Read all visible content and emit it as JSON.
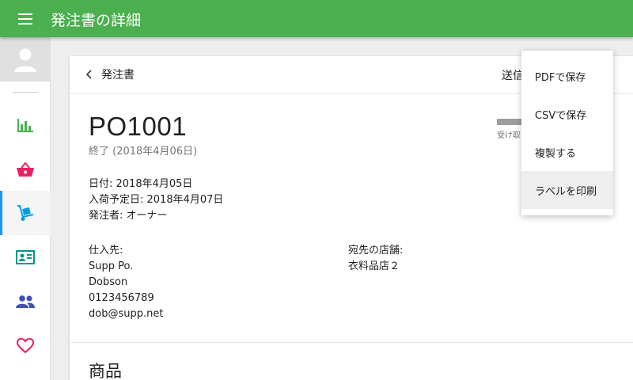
{
  "appbar": {
    "title": "発注書の詳細"
  },
  "colors": {
    "primary": "#4caf50",
    "active_indicator": "#2196f3"
  },
  "sidebar": {
    "items": [
      {
        "name": "reports",
        "icon": "bar-chart-icon",
        "color": "#4caf50"
      },
      {
        "name": "sales",
        "icon": "basket-icon",
        "color": "#e91e63"
      },
      {
        "name": "purchases",
        "icon": "hand-truck-icon",
        "color": "#039be5",
        "active": true
      },
      {
        "name": "contacts",
        "icon": "contact-card-icon",
        "color": "#009688"
      },
      {
        "name": "customers",
        "icon": "people-icon",
        "color": "#3f51b5"
      },
      {
        "name": "favorites",
        "icon": "heart-icon",
        "color": "#e91e63"
      }
    ]
  },
  "header": {
    "back_label": "発注書",
    "send_label": "送信"
  },
  "order": {
    "number": "PO1001",
    "status": "終了 (2018年4月06日)",
    "progress_label": "受け取",
    "date": "日付: 2018年4月05日",
    "expected_date": "入荷予定日: 2018年4月07日",
    "ordered_by": "発注者: オーナー"
  },
  "supplier": {
    "heading": "仕入先:",
    "name": "Supp Po.",
    "contact": "Dobson",
    "phone": "0123456789",
    "email": "dob@supp.net"
  },
  "destination": {
    "heading": "宛先の店舗:",
    "store": "衣料品店２"
  },
  "products": {
    "title": "商品"
  },
  "menu": {
    "items": [
      {
        "label": "PDFで保存"
      },
      {
        "label": "CSVで保存"
      },
      {
        "label": "複製する"
      },
      {
        "label": "ラベルを印刷",
        "hover": true
      }
    ]
  }
}
